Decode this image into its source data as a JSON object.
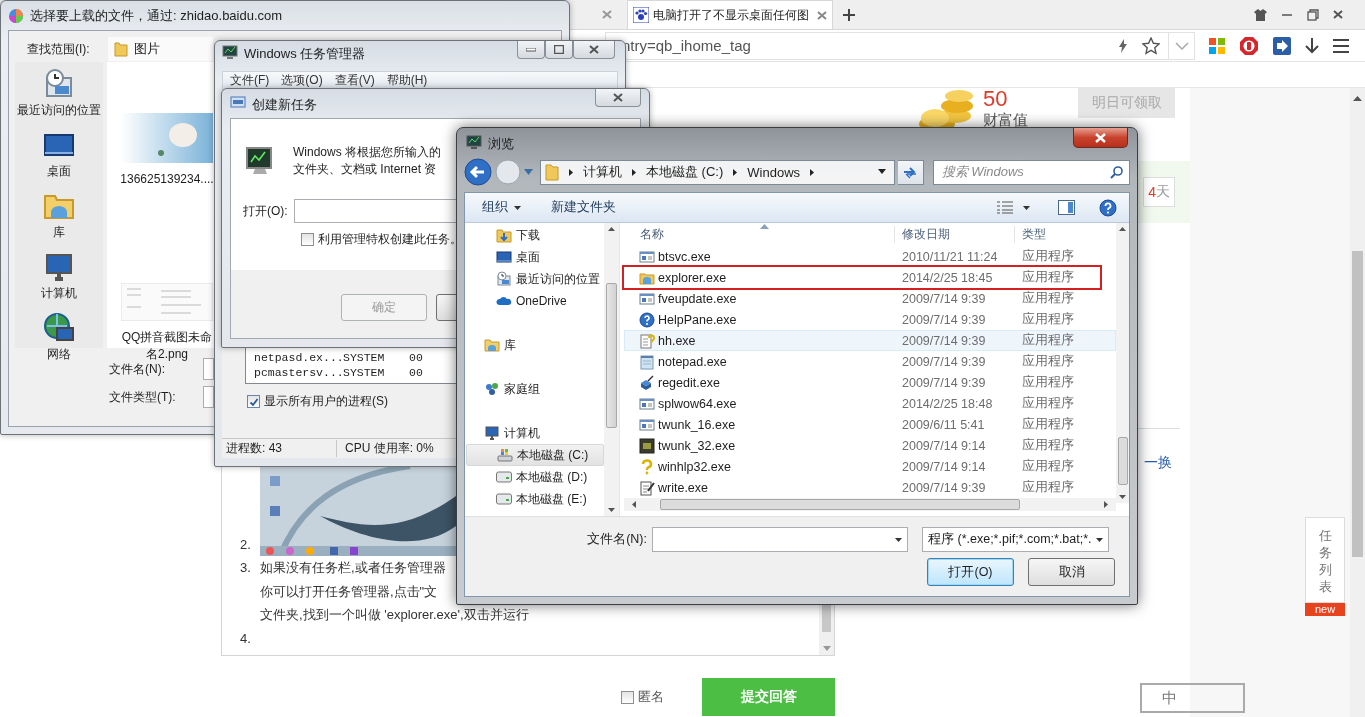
{
  "browser": {
    "tabs": [
      {
        "title": "电脑打开了不显示桌面任何图",
        "selected": true
      }
    ],
    "address": "ntry=qb_ihome_tag"
  },
  "page": {
    "wealth": {
      "value": "50",
      "label": "财富值",
      "button": "明日可领取"
    },
    "task_reminder": {
      "count": "4",
      "suffix": "天"
    },
    "refresh_link": "一换",
    "answer": {
      "items": [
        {
          "marker": "2.",
          "kind": "image"
        },
        {
          "marker": "3.",
          "kind": "text",
          "lines": [
            "如果没有任务栏,或者任务管理器",
            "你可以打开任务管理器,点击\"文",
            "文件夹,找到一个叫做 'explorer.exe',双击并运行"
          ]
        },
        {
          "marker": "4.",
          "kind": "text"
        }
      ]
    },
    "anonymous": {
      "label": "匿名",
      "checked": false
    },
    "submit": "提交回答",
    "task_list": {
      "label": "任务列表",
      "badge": "new"
    },
    "seal": "中"
  },
  "upload_dialog": {
    "title": "选择要上载的文件，通过: zhidao.baidu.com",
    "look_in_label": "查找范围(I):",
    "look_in": "图片",
    "places": [
      {
        "label": "最近访问的位置",
        "kind": "recent"
      },
      {
        "label": "桌面",
        "kind": "desktop"
      },
      {
        "label": "库",
        "kind": "library"
      },
      {
        "label": "计算机",
        "kind": "computer"
      },
      {
        "label": "网络",
        "kind": "network"
      }
    ],
    "files": [
      {
        "name": "136625139234....",
        "kind": "photo"
      },
      {
        "name": "QQ拼音截图未命名2.png",
        "kind": "document"
      }
    ],
    "filename_label": "文件名(N):",
    "filetype_label": "文件类型(T):"
  },
  "task_manager": {
    "title": "Windows 任务管理器",
    "menu": [
      "文件(F)",
      "选项(O)",
      "查看(V)",
      "帮助(H)"
    ],
    "processes": [
      {
        "name": "netpasd.ex...",
        "user": "SYSTEM",
        "cpu": "00"
      },
      {
        "name": "pcmastersv...",
        "user": "SYSTEM",
        "cpu": "00"
      }
    ],
    "show_all": {
      "label": "显示所有用户的进程(S)",
      "checked": true
    },
    "status": [
      "进程数: 43",
      "CPU 使用率: 0%"
    ]
  },
  "run_dialog": {
    "title": "创建新任务",
    "description": [
      "Windows 将根据您所输入的",
      "文件夹、文档或 Internet 资"
    ],
    "open_label": "打开(O):",
    "admin": {
      "label": "利用管理特权创建此任务。",
      "checked": false
    },
    "ok": {
      "label": "确定",
      "disabled": true
    }
  },
  "browse_dialog": {
    "title": "浏览",
    "path": [
      "计算机",
      "本地磁盘 (C:)",
      "Windows"
    ],
    "search_placeholder": "搜索 Windows",
    "toolbar": {
      "organize": "组织",
      "new_folder": "新建文件夹"
    },
    "nav": [
      {
        "children": [
          {
            "label": "下载",
            "kind": "download",
            "selected": false
          },
          {
            "label": "桌面",
            "kind": "desktop",
            "selected": false
          },
          {
            "label": "最近访问的位置",
            "kind": "recent",
            "selected": false
          },
          {
            "label": "OneDrive",
            "kind": "cloud",
            "selected": false
          }
        ]
      },
      {
        "label": "库",
        "kind": "library",
        "selected": false
      },
      {
        "label": "家庭组",
        "kind": "homegroup",
        "selected": false
      },
      {
        "label": "计算机",
        "kind": "computer",
        "selected": false,
        "children": [
          {
            "label": "本地磁盘 (C:)",
            "kind": "windrive",
            "selected": true
          },
          {
            "label": "本地磁盘 (D:)",
            "kind": "drive",
            "selected": false
          },
          {
            "label": "本地磁盘 (E:)",
            "kind": "drive",
            "selected": false
          }
        ]
      }
    ],
    "columns": [
      "名称",
      "修改日期",
      "类型"
    ],
    "files": [
      {
        "name": "btsvc.exe",
        "date": "2010/11/21 11:24",
        "type": "应用程序",
        "kind": "app",
        "highlighted": false,
        "hovered": false
      },
      {
        "name": "explorer.exe",
        "date": "2014/2/25 18:45",
        "type": "应用程序",
        "kind": "folder",
        "highlighted": true,
        "hovered": false
      },
      {
        "name": "fveupdate.exe",
        "date": "2009/7/14 9:39",
        "type": "应用程序",
        "kind": "app",
        "highlighted": false,
        "hovered": false
      },
      {
        "name": "HelpPane.exe",
        "date": "2009/7/14 9:39",
        "type": "应用程序",
        "kind": "help",
        "highlighted": false,
        "hovered": false
      },
      {
        "name": "hh.exe",
        "date": "2009/7/14 9:39",
        "type": "应用程序",
        "kind": "helpdoc",
        "highlighted": false,
        "hovered": true
      },
      {
        "name": "notepad.exe",
        "date": "2009/7/14 9:39",
        "type": "应用程序",
        "kind": "notepad",
        "highlighted": false,
        "hovered": false
      },
      {
        "name": "regedit.exe",
        "date": "2009/7/14 9:39",
        "type": "应用程序",
        "kind": "registry",
        "highlighted": false,
        "hovered": false
      },
      {
        "name": "splwow64.exe",
        "date": "2014/2/25 18:48",
        "type": "应用程序",
        "kind": "app",
        "highlighted": false,
        "hovered": false
      },
      {
        "name": "twunk_16.exe",
        "date": "2009/6/11 5:41",
        "type": "应用程序",
        "kind": "app",
        "highlighted": false,
        "hovered": false
      },
      {
        "name": "twunk_32.exe",
        "date": "2009/7/14 9:14",
        "type": "应用程序",
        "kind": "terminal",
        "highlighted": false,
        "hovered": false
      },
      {
        "name": "winhlp32.exe",
        "date": "2009/7/14 9:14",
        "type": "应用程序",
        "kind": "question",
        "highlighted": false,
        "hovered": false
      },
      {
        "name": "write.exe",
        "date": "2009/7/14 9:39",
        "type": "应用程序",
        "kind": "write",
        "highlighted": false,
        "hovered": false
      }
    ],
    "filename_label": "文件名(N):",
    "filter": "程序 (*.exe;*.pif;*.com;*.bat;*.",
    "buttons": [
      {
        "label": "打开(O)",
        "default": true
      },
      {
        "label": "取消",
        "default": false
      }
    ]
  }
}
